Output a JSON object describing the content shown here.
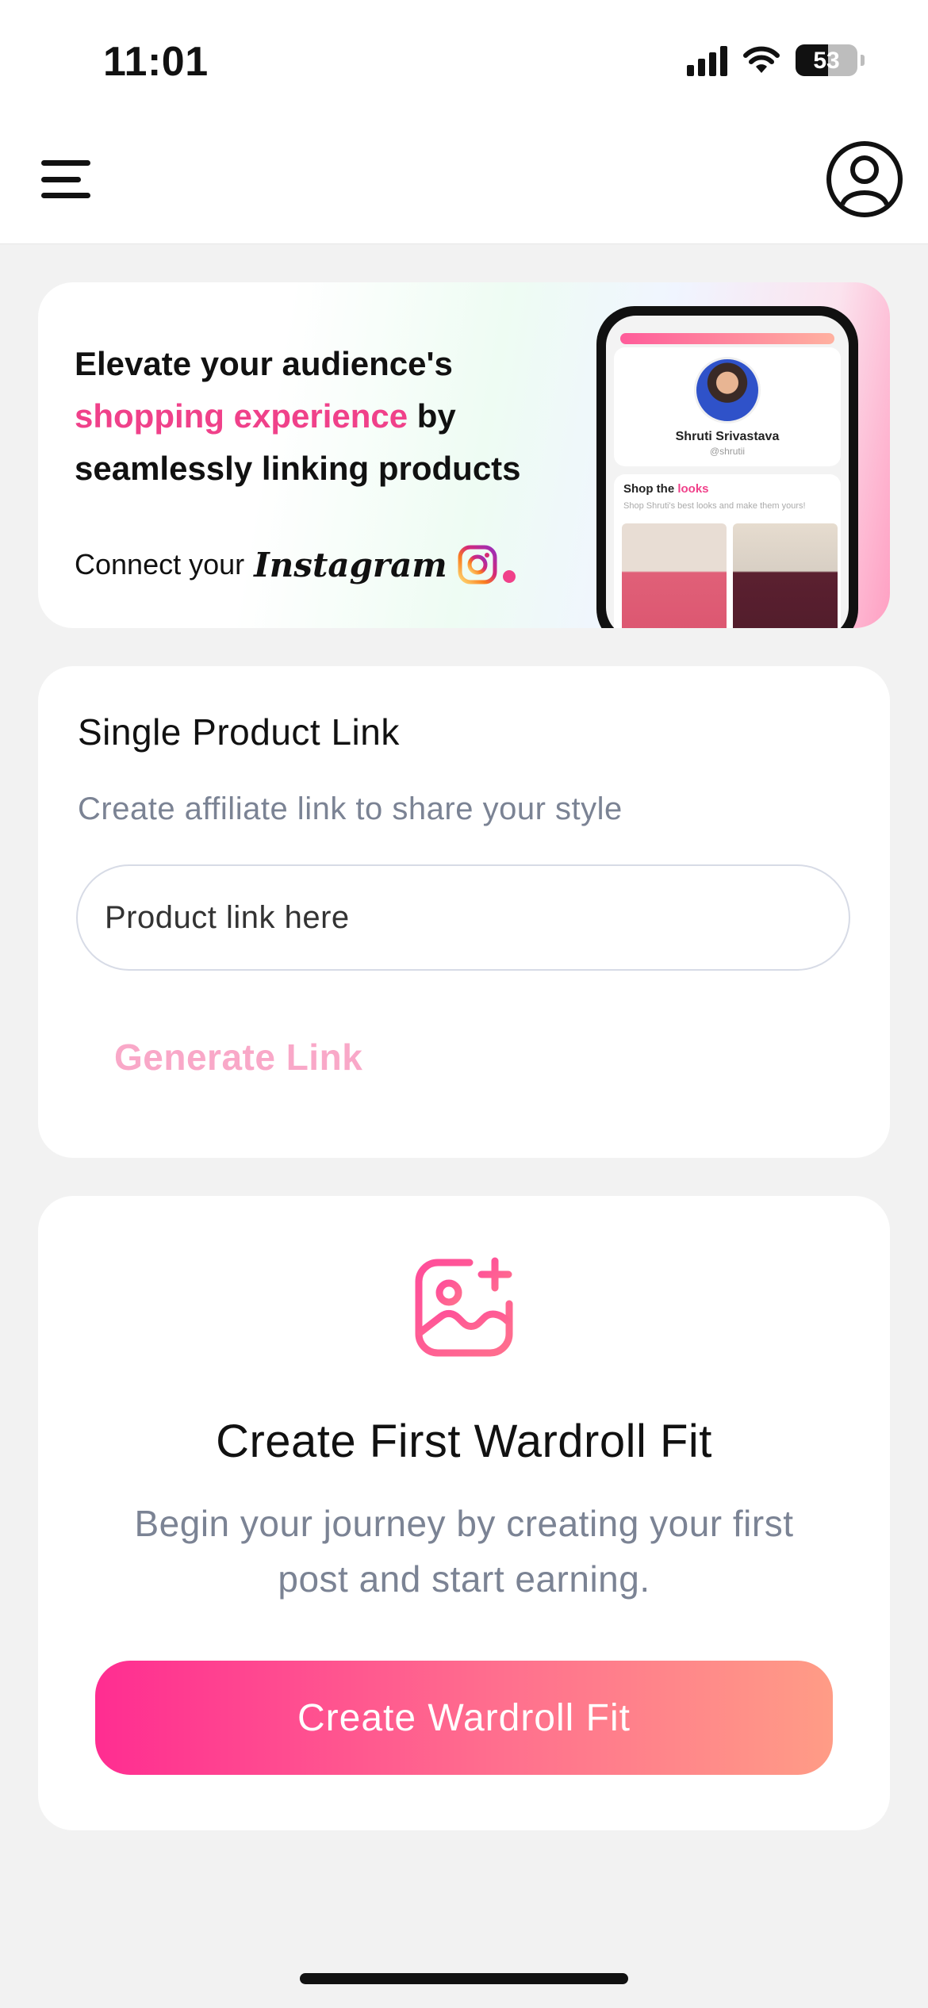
{
  "status_bar": {
    "time": "11:01",
    "battery": "53",
    "battery_level_percent": 53
  },
  "header": {
    "menu_icon": "hamburger-menu-icon",
    "profile_icon": "user-circle-icon"
  },
  "banner": {
    "headline_part1": "Elevate your audience's",
    "headline_highlight": "shopping experience",
    "headline_part2": "by",
    "headline_part3": "seamlessly linking products",
    "connect_prefix": "Connect your",
    "connect_platform": "Instagram",
    "phone": {
      "name": "Shruti Srivastava",
      "handle": "@shrutii",
      "shop_title_prefix": "Shop the",
      "shop_title_highlight": "looks",
      "shop_subtitle": "Shop Shruti's best looks and make them yours!"
    }
  },
  "single_link": {
    "title": "Single Product Link",
    "subtitle": "Create affiliate link to share your style",
    "input_placeholder": "Product link here",
    "input_value": "",
    "generate_label": "Generate Link"
  },
  "empty_state": {
    "icon": "image-add-icon",
    "title": "Create First Wardroll Fit",
    "description": "Begin your journey by creating your first post and start earning.",
    "button_label": "Create Wardroll Fit"
  },
  "colors": {
    "accent_pink": "#f0418a",
    "gradient_start": "#ff2d91",
    "gradient_end": "#ff9c86",
    "muted_text": "#7b8394",
    "disabled_pink": "#f9a8c8"
  }
}
